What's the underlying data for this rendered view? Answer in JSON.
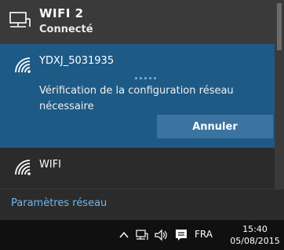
{
  "connected": {
    "name": "WIFI 2",
    "status": "Connecté",
    "icon": "ethernet-computer-icon"
  },
  "selected_network": {
    "ssid": "YDXJ_5031935",
    "message": "Vérification de la configuration réseau nécessaire",
    "cancel_label": "Annuler",
    "icon": "wifi-signal-icon"
  },
  "other_network": {
    "ssid": "WIFI",
    "icon": "wifi-signal-icon"
  },
  "settings_link": "Paramètres réseau",
  "taskbar": {
    "language": "FRA",
    "time": "15:40",
    "date": "05/08/2015",
    "icons": [
      "chevron-up-icon",
      "network-icon",
      "volume-icon",
      "action-center-icon"
    ]
  },
  "colors": {
    "flyout_bg": "#2b2b2b",
    "selected_bg": "#1e5a86",
    "button_bg": "#3b74a1",
    "link": "#6fb6ee",
    "taskbar_bg": "#101010"
  }
}
